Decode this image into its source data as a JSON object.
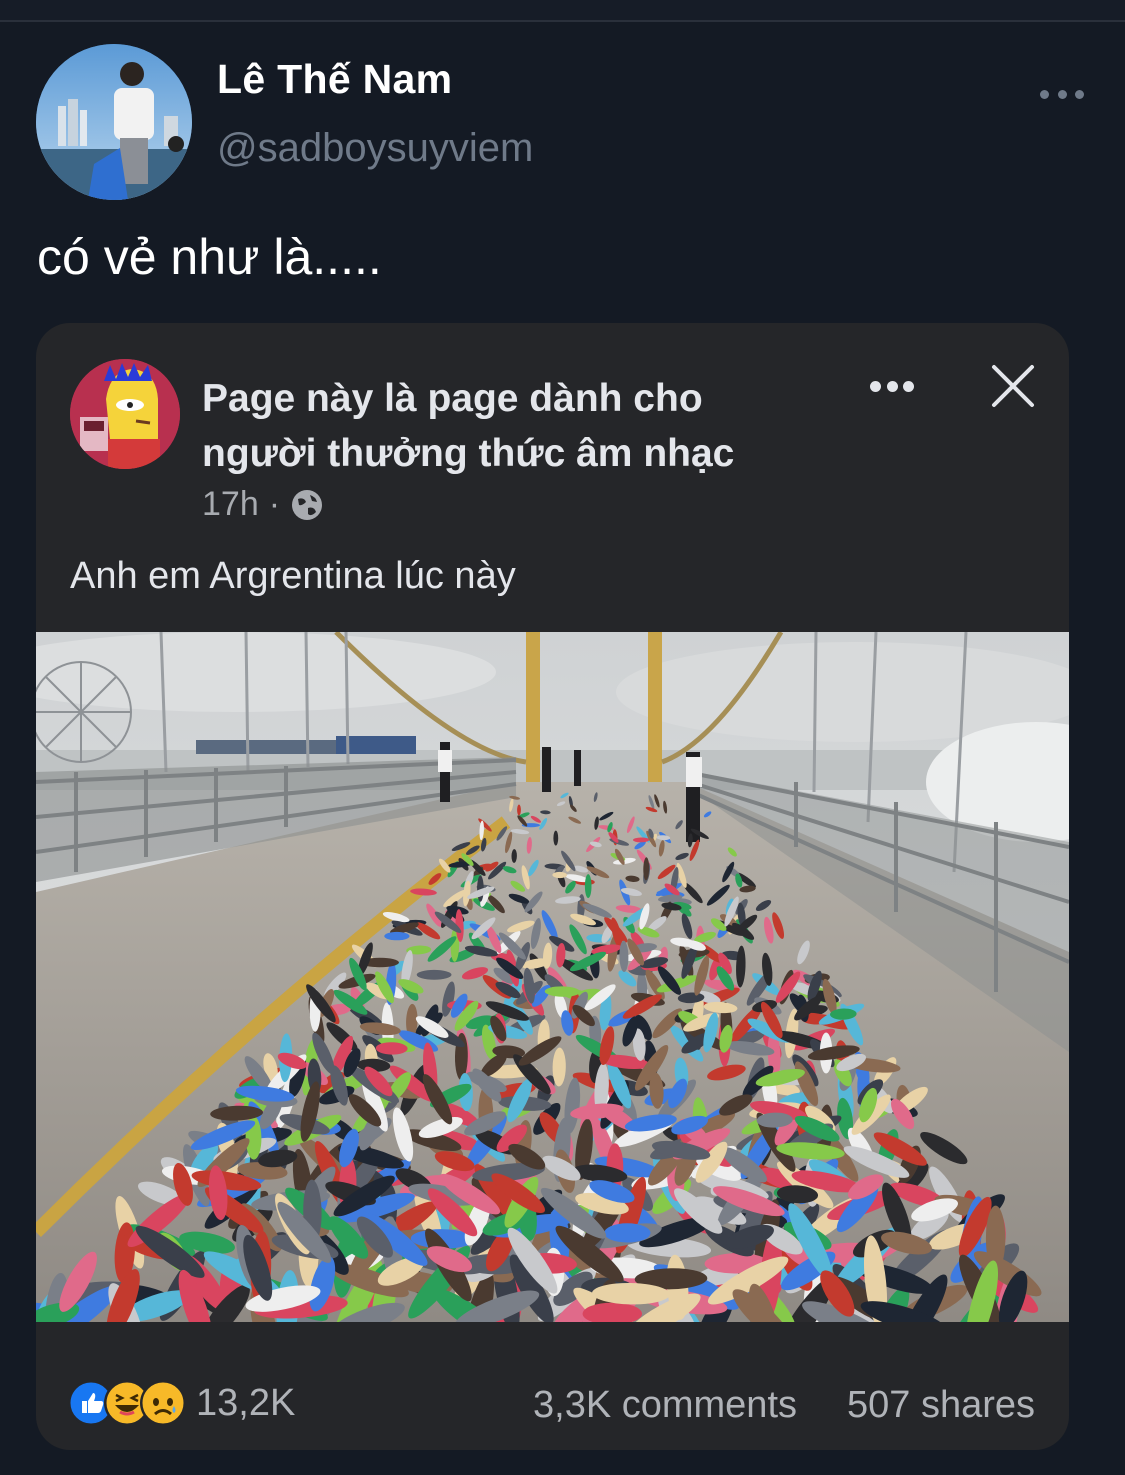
{
  "tweet": {
    "author_name": "Lê Thế Nam",
    "author_handle": "@sadboysuyviem",
    "text": "có vẻ như là.....",
    "more_icon": "more-horizontal-icon"
  },
  "shared_post": {
    "page_name": "Page này là page dành cho người thưởng thức âm nhạc",
    "time": "17h",
    "separator": "·",
    "audience_icon": "globe-icon",
    "caption": "Anh em Argrentina lúc này",
    "photo_subject": "bridge covered with abandoned shoes and sandals",
    "reactions": {
      "icons": [
        "like-icon",
        "haha-icon",
        "sad-icon"
      ],
      "count": "13,2K"
    },
    "comments": "3,3K comments",
    "shares": "507 shares"
  },
  "colors": {
    "background": "#141a24",
    "card": "#252629",
    "handle": "#6f7a89",
    "like_blue": "#1877f2",
    "emoji_yellow": "#f7b928"
  }
}
